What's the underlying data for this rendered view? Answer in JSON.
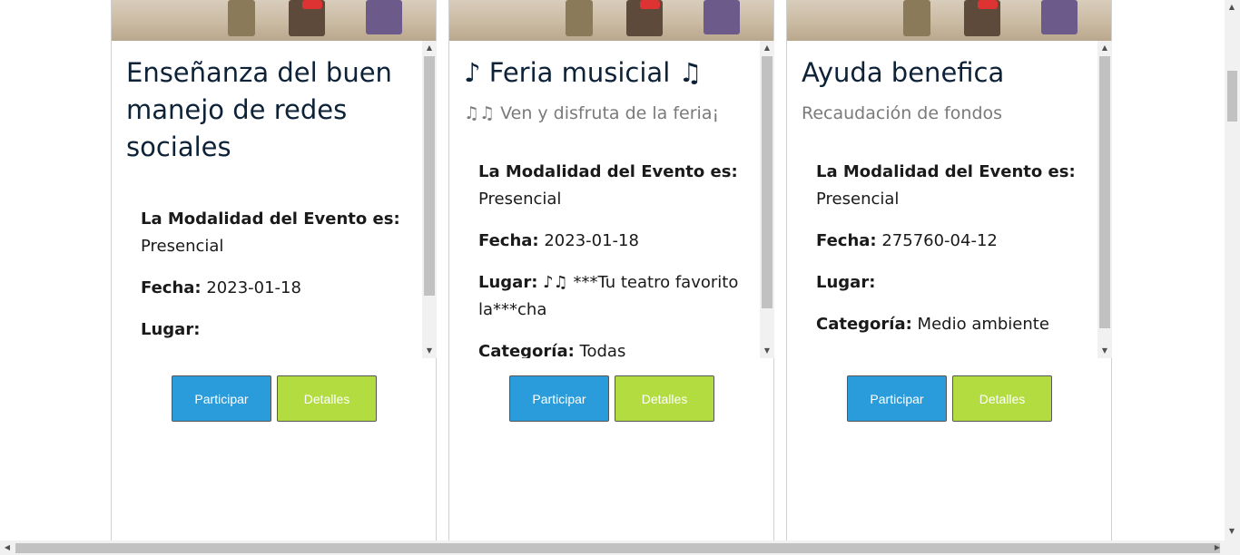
{
  "cards": [
    {
      "title": "Enseñanza del buen manejo de redes sociales",
      "subtitle": "",
      "modalidad_label": "La Modalidad del Evento es:",
      "modalidad": "Presencial",
      "fecha_label": "Fecha:",
      "fecha": "2023-01-18",
      "lugar_label": "Lugar:",
      "lugar": "",
      "participar": "Participar",
      "detalles": "Detalles"
    },
    {
      "title": "♪ Feria musicial ♫",
      "subtitle": "♫♫ Ven y disfruta de la feria¡",
      "modalidad_label": "La Modalidad del Evento es:",
      "modalidad": "Presencial",
      "fecha_label": "Fecha:",
      "fecha": "2023-01-18",
      "lugar_label": "Lugar:",
      "lugar": "♪♫ ***Tu teatro favorito la***cha",
      "categoria_label": "Categoría:",
      "categoria": "Todas",
      "participar": "Participar",
      "detalles": "Detalles"
    },
    {
      "title": "Ayuda benefica",
      "subtitle": "Recaudación de fondos",
      "modalidad_label": "La Modalidad del Evento es:",
      "modalidad": "Presencial",
      "fecha_label": "Fecha:",
      "fecha": "275760-04-12",
      "lugar_label": "Lugar:",
      "lugar": "",
      "categoria_label": "Categoría:",
      "categoria": "Medio ambiente",
      "participar": "Participar",
      "detalles": "Detalles"
    }
  ],
  "colors": {
    "participar": "#2a9cdb",
    "detalles": "#b3dc41",
    "title": "#0d2137"
  }
}
